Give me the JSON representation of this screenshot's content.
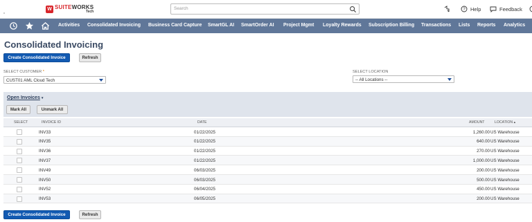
{
  "brand": {
    "name_red": "SUITE",
    "name_dark": "WORKS",
    "sub": "Tech",
    "color": "#d8262b"
  },
  "search": {
    "placeholder": "Search"
  },
  "topright": {
    "help": "Help",
    "feedback": "Feedback"
  },
  "nav": {
    "items": [
      "Activities",
      "Consolidated Invoicing",
      "Business Card Capture",
      "SmartGL AI",
      "SmartOrder AI",
      "Project Mgmt",
      "Loyalty Rewards",
      "Subscription Billing",
      "Transactions",
      "Lists",
      "Reports",
      "Analytics"
    ],
    "bg_color": "#607799"
  },
  "page": {
    "title": "Consolidated Invoicing"
  },
  "buttons": {
    "create": "Create Consolidated Invoice",
    "refresh": "Refresh"
  },
  "filters": {
    "customer_label": "Select Customer",
    "customer_required": "*",
    "customer_value": "CUST01 AML Cloud Tech",
    "location_label": "Select Location",
    "location_value": "-- All Locations --"
  },
  "sublist": {
    "title": "Open Invoices",
    "mark_all": "Mark All",
    "unmark_all": "Unmark All"
  },
  "table": {
    "headers": {
      "select": "Select",
      "invoice_id": "Invoice ID",
      "date": "Date",
      "amount": "Amount",
      "location": "Location ▴"
    },
    "rows": [
      {
        "id": "INV33",
        "date": "01/22/2025",
        "amount": "1,260.00",
        "location": "US Warehouse"
      },
      {
        "id": "INV35",
        "date": "01/22/2025",
        "amount": "640.00",
        "location": "US Warehouse"
      },
      {
        "id": "INV36",
        "date": "01/22/2025",
        "amount": "270.00",
        "location": "US Warehouse"
      },
      {
        "id": "INV37",
        "date": "01/22/2025",
        "amount": "1,000.00",
        "location": "US Warehouse"
      },
      {
        "id": "INV49",
        "date": "06/03/2025",
        "amount": "200.00",
        "location": "US Warehouse"
      },
      {
        "id": "INV50",
        "date": "06/03/2025",
        "amount": "500.00",
        "location": "US Warehouse"
      },
      {
        "id": "INV52",
        "date": "06/04/2025",
        "amount": "450.00",
        "location": "US Warehouse"
      },
      {
        "id": "INV53",
        "date": "06/05/2025",
        "amount": "200.00",
        "location": "US Warehouse"
      }
    ]
  }
}
